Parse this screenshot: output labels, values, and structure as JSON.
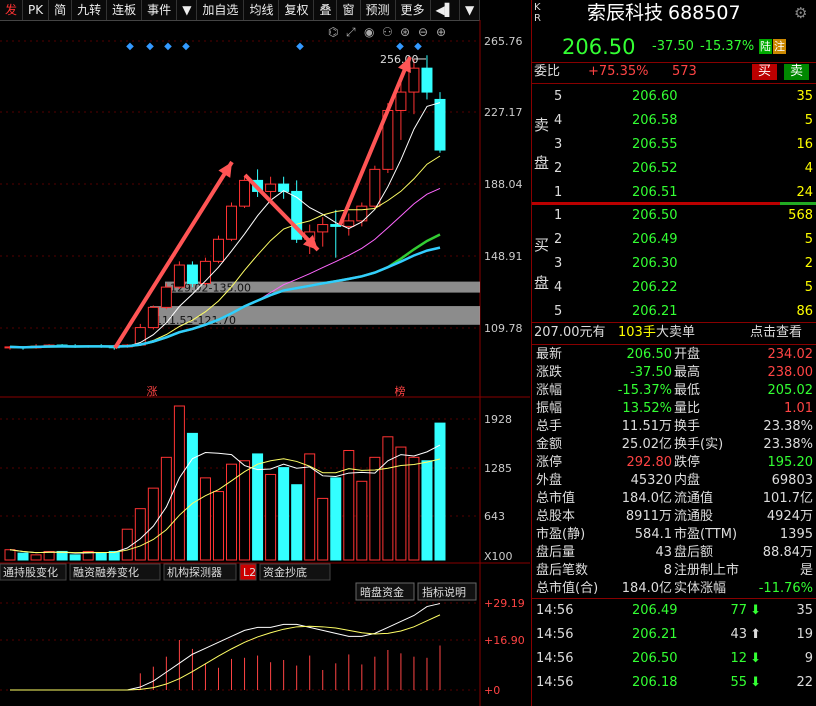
{
  "toolbar": {
    "items": [
      "发",
      "PK",
      "简",
      "九转",
      "连板",
      "事件",
      "▼",
      "加自选",
      "均线",
      "复权",
      "叠",
      "窗",
      "预测",
      "更多",
      "◀▌",
      "▼"
    ]
  },
  "chart_data": {
    "type": "candlestick",
    "price_axis": [
      "265.76",
      "227.17",
      "188.04",
      "148.91",
      "109.78"
    ],
    "peak_label": "256.00",
    "zone_labels": [
      "129.02-135.00",
      "111.52-121.70"
    ],
    "markers": [
      "涨",
      "榜"
    ],
    "volume_axis": [
      "1928",
      "1285",
      "643",
      "X100"
    ],
    "indicator_axis": [
      "+29.19",
      "+16.90",
      "+0"
    ],
    "indicator_tabs": [
      "通持股变化",
      "融资融券变化",
      "机构探测器",
      "L2",
      "资金抄底"
    ],
    "indicator_buttons": [
      "暗盘资金",
      "指标说明"
    ],
    "candles": [
      [
        99,
        100,
        98,
        99.5
      ],
      [
        99.5,
        100,
        98,
        99
      ],
      [
        99,
        101,
        98.5,
        100
      ],
      [
        100,
        101,
        99,
        100.5
      ],
      [
        100.5,
        101,
        99.5,
        100
      ],
      [
        100,
        101,
        99,
        99.5
      ],
      [
        99.5,
        100.5,
        99,
        100
      ],
      [
        100,
        101,
        99,
        99.6
      ],
      [
        99.6,
        100.6,
        98,
        99.5
      ],
      [
        99.5,
        101,
        99,
        100.5
      ],
      [
        100.5,
        112,
        100,
        110
      ],
      [
        110,
        122,
        109,
        121
      ],
      [
        121,
        134,
        120,
        132
      ],
      [
        132,
        146,
        131,
        144
      ],
      [
        144,
        146,
        132,
        134
      ],
      [
        134,
        148,
        133,
        146
      ],
      [
        146,
        160,
        145,
        158
      ],
      [
        158,
        178,
        157,
        176
      ],
      [
        176,
        192,
        175,
        190
      ],
      [
        190,
        196,
        181,
        184
      ],
      [
        184,
        192,
        178,
        188
      ],
      [
        188,
        192,
        180,
        184
      ],
      [
        184,
        190,
        156,
        158
      ],
      [
        158,
        166,
        150,
        162
      ],
      [
        162,
        170,
        154,
        166
      ],
      [
        166,
        174,
        148,
        165
      ],
      [
        165,
        172,
        160,
        168
      ],
      [
        168,
        178,
        165,
        176
      ],
      [
        176,
        198,
        174,
        196
      ],
      [
        196,
        232,
        194,
        228
      ],
      [
        228,
        244,
        212,
        238
      ],
      [
        238,
        256,
        226,
        251
      ],
      [
        251,
        258,
        234,
        238
      ],
      [
        234,
        238,
        205,
        206.5
      ]
    ],
    "volume": [
      30,
      20,
      15,
      25,
      25,
      15,
      25,
      20,
      25,
      90,
      150,
      210,
      300,
      450,
      370,
      240,
      200,
      280,
      290,
      310,
      250,
      270,
      220,
      310,
      180,
      240,
      320,
      230,
      300,
      360,
      330,
      300,
      290,
      400
    ]
  },
  "stock": {
    "name": "索辰科技",
    "code": "688507",
    "price": "206.50",
    "change": "-37.50",
    "change_pct": "-15.37%",
    "tag1": "陆",
    "tag2": "注",
    "badge": "K R"
  },
  "weibi": {
    "label": "委比",
    "value": "+75.35%",
    "diff": "573",
    "buy": "买",
    "sell": "卖"
  },
  "sell": [
    {
      "n": "5",
      "p": "206.60",
      "v": "35"
    },
    {
      "n": "4",
      "p": "206.58",
      "v": "5"
    },
    {
      "n": "3",
      "p": "206.55",
      "v": "16"
    },
    {
      "n": "2",
      "p": "206.52",
      "v": "4"
    },
    {
      "n": "1",
      "p": "206.51",
      "v": "24"
    }
  ],
  "buy": [
    {
      "n": "1",
      "p": "206.50",
      "v": "568"
    },
    {
      "n": "2",
      "p": "206.49",
      "v": "5"
    },
    {
      "n": "3",
      "p": "206.30",
      "v": "2"
    },
    {
      "n": "4",
      "p": "206.22",
      "v": "5"
    },
    {
      "n": "5",
      "p": "206.21",
      "v": "86"
    }
  ],
  "sell_label": [
    "卖",
    "盘"
  ],
  "buy_label": [
    "买",
    "盘"
  ],
  "bigorder": {
    "price": "207.00元有",
    "qty": "103手",
    "label": "大卖单",
    "link": "点击查看"
  },
  "stats": [
    [
      "最新",
      "206.50",
      "开盘",
      "234.02"
    ],
    [
      "涨跌",
      "-37.50",
      "最高",
      "238.00"
    ],
    [
      "涨幅",
      "-15.37%",
      "最低",
      "205.02"
    ],
    [
      "振幅",
      "13.52%",
      "量比",
      "1.01"
    ],
    [
      "总手",
      "11.51万",
      "换手",
      "23.38%"
    ],
    [
      "金额",
      "25.02亿",
      "换手(实)",
      "23.38%"
    ],
    [
      "涨停",
      "292.80",
      "跌停",
      "195.20"
    ],
    [
      "外盘",
      "45320",
      "内盘",
      "69803"
    ],
    [
      "总市值",
      "184.0亿",
      "流通值",
      "101.7亿"
    ],
    [
      "总股本",
      "8911万",
      "流通股",
      "4924万"
    ],
    [
      "市盈(静)",
      "584.1",
      "市盈(TTM)",
      "1395"
    ],
    [
      "盘后量",
      "43",
      "盘后额",
      "88.84万"
    ],
    [
      "盘后笔数",
      "8",
      "注册制上市",
      "是"
    ],
    [
      "总市值(合)",
      "184.0亿",
      "实体涨幅",
      "-11.76%"
    ]
  ],
  "ticks": [
    [
      "14:56",
      "206.49",
      "77",
      "35"
    ],
    [
      "14:56",
      "206.21",
      "43",
      "19"
    ],
    [
      "14:56",
      "206.50",
      "12",
      "9"
    ],
    [
      "14:56",
      "206.18",
      "55",
      "22"
    ]
  ],
  "tick_dirs": [
    "down",
    "up",
    "down",
    "down"
  ],
  "colors": {
    "up": "#ff3333",
    "down": "#33ffff",
    "ma1": "#ffffff",
    "ma2": "#ffff66",
    "ma3": "#ff66ff",
    "ma4": "#33cc33",
    "ma5": "#33ccff",
    "arrow": "#ff5555"
  }
}
